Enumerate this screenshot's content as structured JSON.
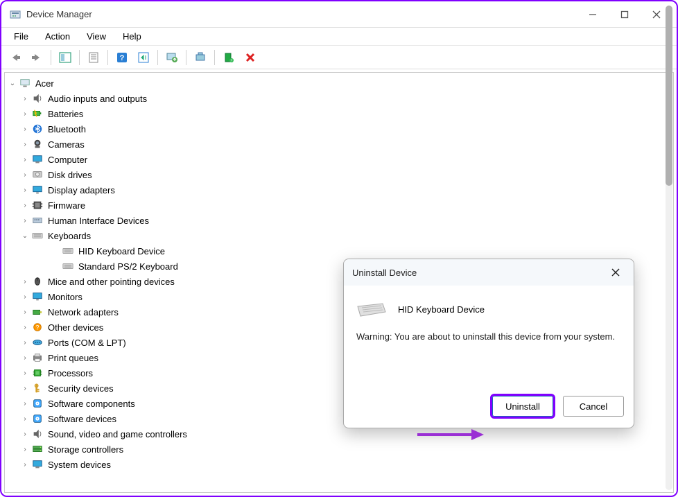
{
  "window": {
    "title": "Device Manager"
  },
  "menubar": [
    "File",
    "Action",
    "View",
    "Help"
  ],
  "tree": {
    "root": "Acer",
    "nodes": [
      {
        "label": "Audio inputs and outputs",
        "icon": "audio"
      },
      {
        "label": "Batteries",
        "icon": "battery"
      },
      {
        "label": "Bluetooth",
        "icon": "bluetooth"
      },
      {
        "label": "Cameras",
        "icon": "camera"
      },
      {
        "label": "Computer",
        "icon": "computer"
      },
      {
        "label": "Disk drives",
        "icon": "disk"
      },
      {
        "label": "Display adapters",
        "icon": "display"
      },
      {
        "label": "Firmware",
        "icon": "firmware"
      },
      {
        "label": "Human Interface Devices",
        "icon": "hid"
      },
      {
        "label": "Keyboards",
        "icon": "keyboard",
        "expanded": true,
        "children": [
          {
            "label": "HID Keyboard Device",
            "icon": "keyboard"
          },
          {
            "label": "Standard PS/2 Keyboard",
            "icon": "keyboard"
          }
        ]
      },
      {
        "label": "Mice and other pointing devices",
        "icon": "mouse"
      },
      {
        "label": "Monitors",
        "icon": "monitor"
      },
      {
        "label": "Network adapters",
        "icon": "network"
      },
      {
        "label": "Other devices",
        "icon": "other"
      },
      {
        "label": "Ports (COM & LPT)",
        "icon": "port"
      },
      {
        "label": "Print queues",
        "icon": "printer"
      },
      {
        "label": "Processors",
        "icon": "cpu"
      },
      {
        "label": "Security devices",
        "icon": "security"
      },
      {
        "label": "Software components",
        "icon": "software"
      },
      {
        "label": "Software devices",
        "icon": "software"
      },
      {
        "label": "Sound, video and game controllers",
        "icon": "sound"
      },
      {
        "label": "Storage controllers",
        "icon": "storage"
      },
      {
        "label": "System devices",
        "icon": "system"
      }
    ]
  },
  "dialog": {
    "title": "Uninstall Device",
    "device": "HID Keyboard Device",
    "warning": "Warning: You are about to uninstall this device from your system.",
    "ok": "Uninstall",
    "cancel": "Cancel"
  }
}
